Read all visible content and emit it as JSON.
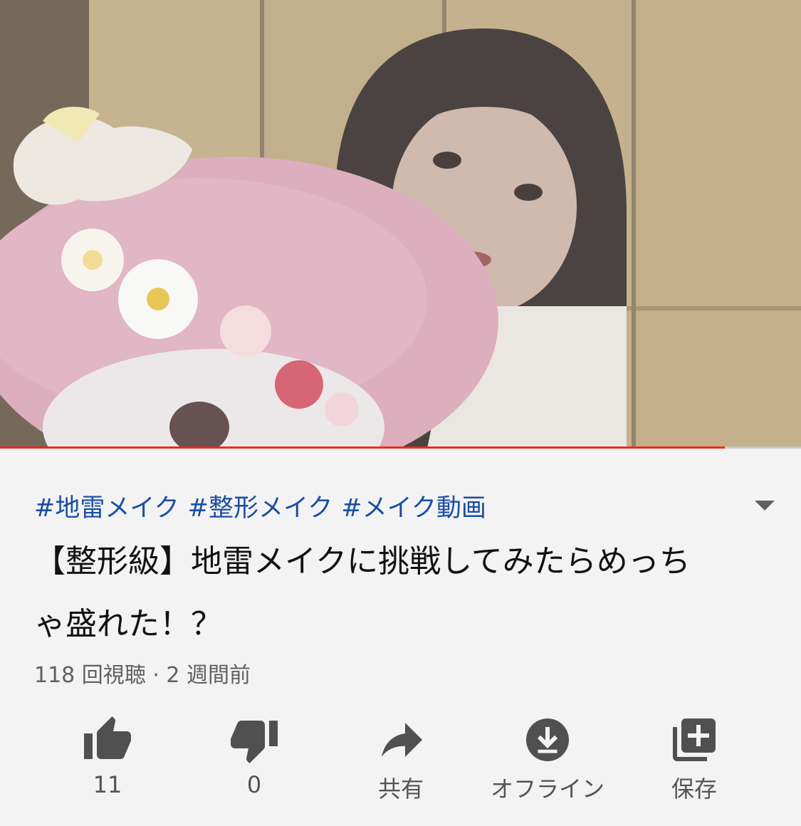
{
  "video": {
    "progress_fraction": 0.905
  },
  "hashtags": [
    "#地雷メイク",
    "#整形メイク",
    "#メイク動画"
  ],
  "title": "【整形級】地雷メイクに挑戦してみたらめっちゃ盛れた！？",
  "meta": {
    "text": "118 回視聴 · 2 週間前"
  },
  "actions": [
    {
      "id": "like",
      "label": "11",
      "icon": "thumb-up-icon"
    },
    {
      "id": "dislike",
      "label": "0",
      "icon": "thumb-down-icon"
    },
    {
      "id": "share",
      "label": "共有",
      "icon": "share-arrow-icon"
    },
    {
      "id": "offline",
      "label": "オフライン",
      "icon": "download-icon"
    },
    {
      "id": "save",
      "label": "保存",
      "icon": "playlist-add-icon"
    }
  ],
  "colors": {
    "progress": "#ee2a1f",
    "hashtag": "#1a4ea3",
    "icon": "#505050",
    "background": "#f3f3f3"
  }
}
